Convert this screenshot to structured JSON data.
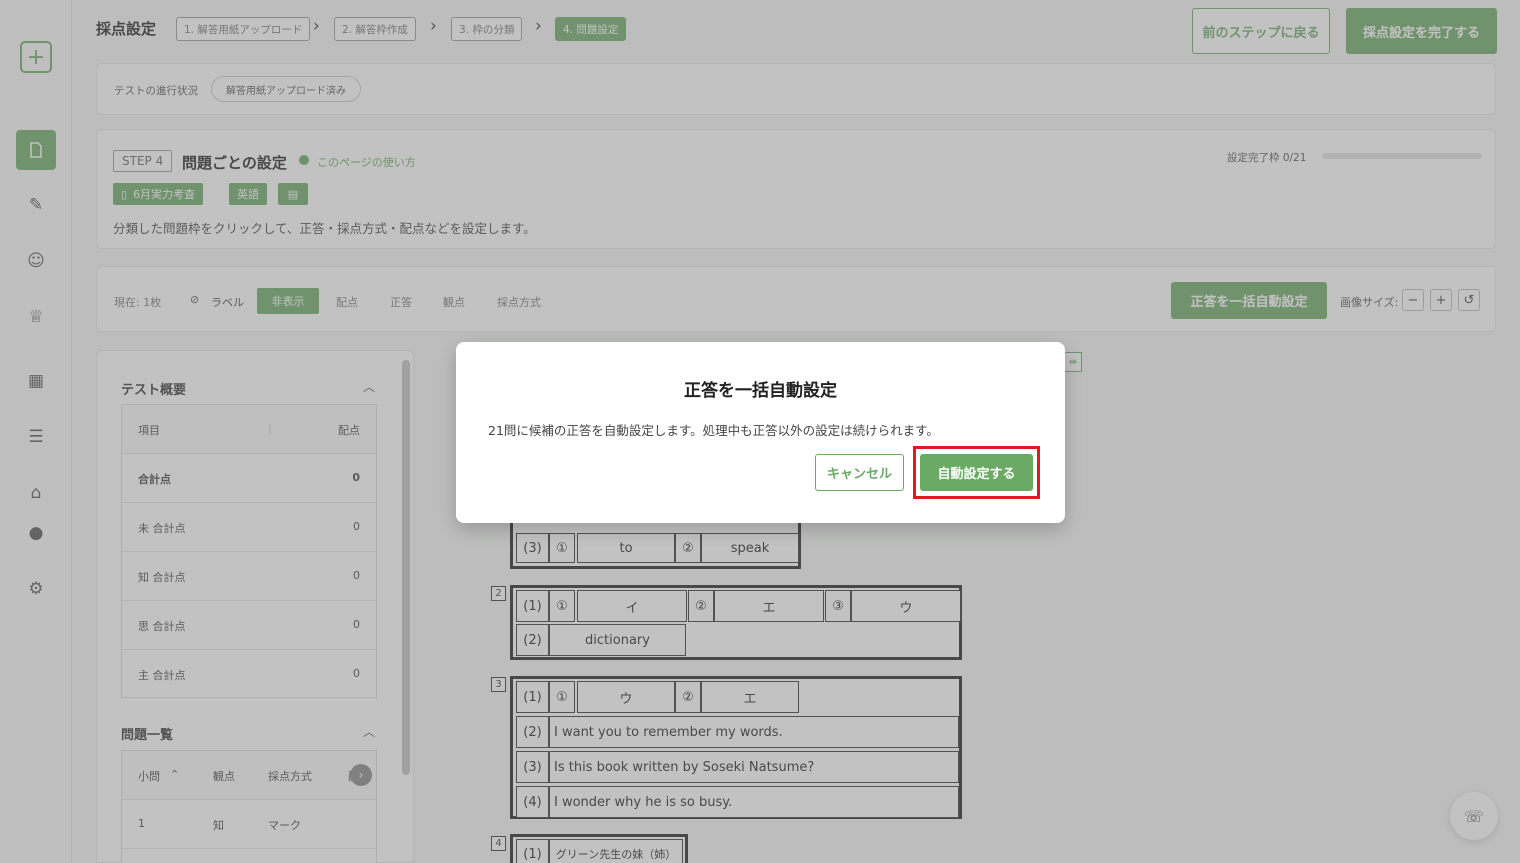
{
  "header": {
    "title": "採点設定",
    "steps": [
      "1. 解答用紙アップロード",
      "2. 解答枠作成",
      "3. 枠の分類",
      "4. 問題設定"
    ],
    "prev_button": "前のステップに戻る",
    "complete_button": "採点設定を完了する"
  },
  "progress": {
    "label": "テストの進行状況",
    "status": "解答用紙アップロード済み"
  },
  "step_card": {
    "step_tag": "STEP 4",
    "title": "問題ごとの設定",
    "help_link": "このページの使い方",
    "setting_progress": "設定完了枠 0/21",
    "setting_progress_fraction": 0,
    "test_tag": "6月実力考査",
    "subject_tag": "英語",
    "description": "分類した問題枠をクリックして、正答・採点方式・配点などを設定します。"
  },
  "toolbar": {
    "current": "現在: 1枚",
    "label": "ラベル",
    "hide": "非表示",
    "points": "配点",
    "correct": "正答",
    "viewpoint": "観点",
    "method": "採点方式",
    "auto_set_button": "正答を一括自動設定",
    "image_size": "画像サイズ:",
    "minus": "−",
    "plus": "+",
    "reset": "↺"
  },
  "overview": {
    "title": "テスト概要",
    "col_item": "項目",
    "col_points": "配点",
    "rows": [
      {
        "label": "合計点",
        "value": "0"
      },
      {
        "label": "未 合計点",
        "value": "0"
      },
      {
        "label": "知 合計点",
        "value": "0"
      },
      {
        "label": "思 合計点",
        "value": "0"
      },
      {
        "label": "主 合計点",
        "value": "0"
      }
    ]
  },
  "question_list": {
    "title": "問題一覧",
    "col_q": "小問",
    "col_view": "観点",
    "col_method": "採点方式",
    "col_points": "配点",
    "rows": [
      {
        "q": "1",
        "view": "知",
        "method": "マーク"
      }
    ]
  },
  "answer_sheet": {
    "q1_row3": {
      "num": "(3)",
      "c1": "①",
      "a1": "to",
      "c2": "②",
      "a2": "speak"
    },
    "q2": {
      "num": "2",
      "row1": {
        "num": "(1)",
        "c1": "①",
        "a1": "イ",
        "c2": "②",
        "a2": "エ",
        "c3": "③",
        "a3": "ウ"
      },
      "row2": {
        "num": "(2)",
        "a1": "dictionary"
      }
    },
    "q3": {
      "num": "3",
      "row1": {
        "num": "(1)",
        "c1": "①",
        "a1": "ウ",
        "c2": "②",
        "a2": "エ"
      },
      "row2": {
        "num": "(2)",
        "a1": "I want you to remember my words."
      },
      "row3": {
        "num": "(3)",
        "a1": "Is this book written by Soseki Natsume?"
      },
      "row4": {
        "num": "(4)",
        "a1": "I wonder why he is so busy."
      }
    },
    "q4": {
      "num": "4",
      "row1": {
        "num": "(1)",
        "a1": "グリーン先生の妹（姉）"
      }
    }
  },
  "modal": {
    "title": "正答を一括自動設定",
    "message": "21問に候補の正答を自動設定します。処理中も正答以外の設定は続けられます。",
    "cancel": "キャンセル",
    "confirm": "自動設定する"
  },
  "colors": {
    "accent": "#6aaa64",
    "highlight": "#d81e1e"
  }
}
